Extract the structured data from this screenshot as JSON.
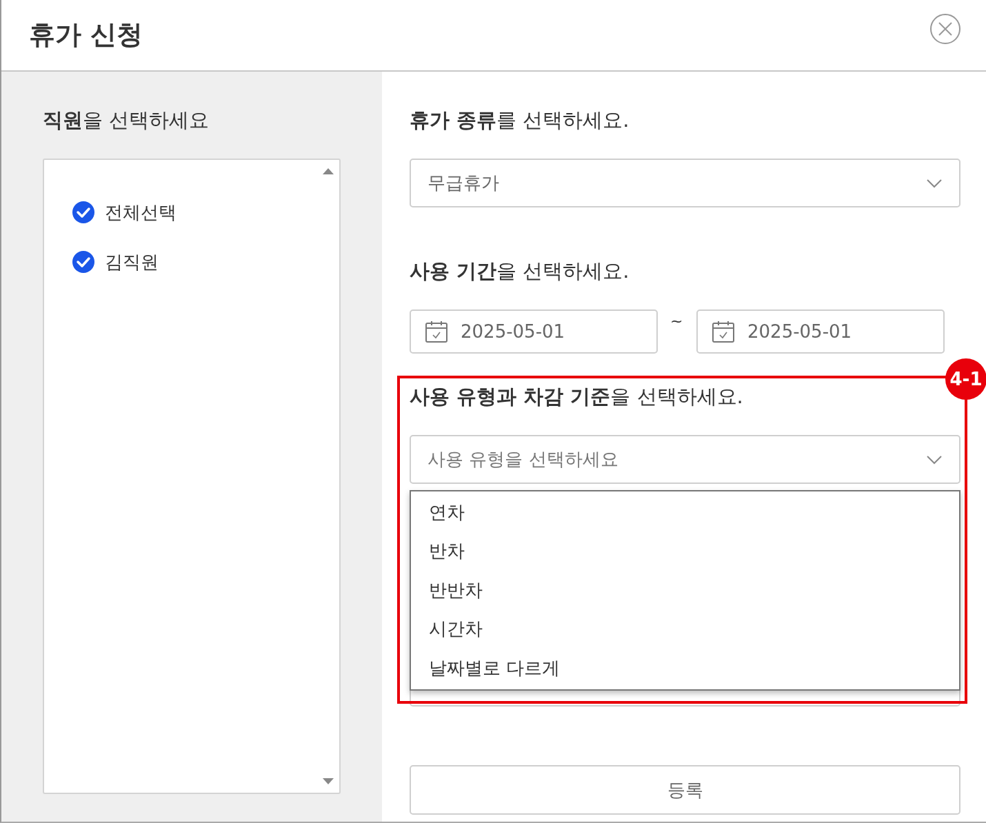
{
  "window": {
    "title": "휴가 신청"
  },
  "employee_panel": {
    "heading": "**직원**을 선택하세요",
    "items": [
      {
        "label": "전체선택",
        "checked": true
      },
      {
        "label": "김직원",
        "checked": true
      }
    ]
  },
  "leave_type": {
    "heading": "**휴가 종류**를 선택하세요.",
    "value": "무급휴가"
  },
  "period": {
    "heading": "**사용 기간**을 선택하세요.",
    "start": "2025-05-01",
    "separator": "~",
    "end": "2025-05-01"
  },
  "usage_type": {
    "heading": "**사용 유형과 차감 기준**을 선택하세요.",
    "placeholder": "사용 유형을 선택하세요",
    "expanded": true,
    "options": [
      "연차",
      "반차",
      "반반차",
      "시간차",
      "날짜별로 다르게"
    ]
  },
  "annotation": {
    "label": "4-1"
  },
  "submit_button": "등록"
}
